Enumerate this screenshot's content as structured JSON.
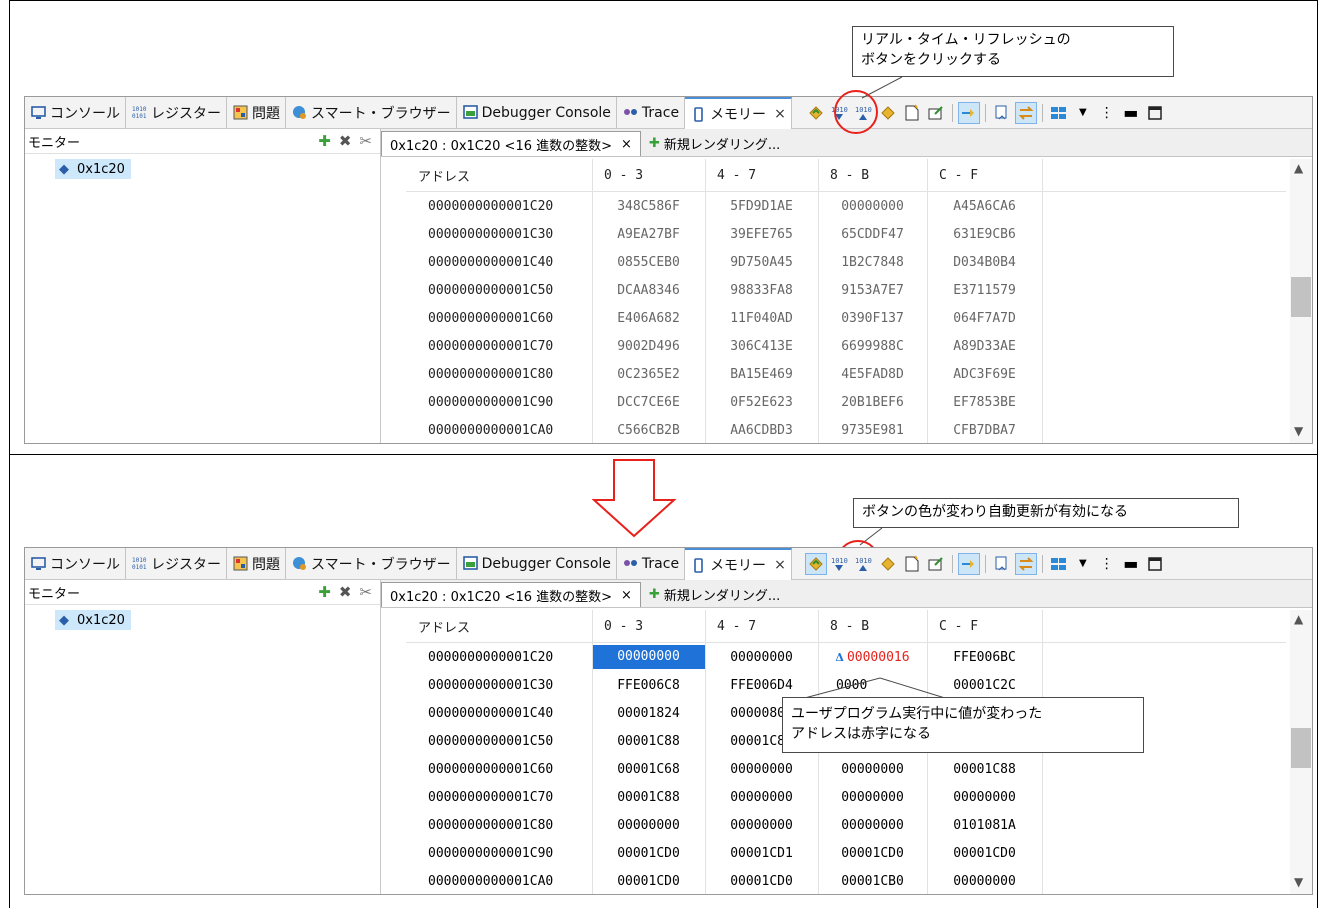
{
  "tabs": [
    {
      "label": "コンソール",
      "icon": "console-icon"
    },
    {
      "label": "レジスター",
      "icon": "binary-register-icon"
    },
    {
      "label": "問題",
      "icon": "problems-icon"
    },
    {
      "label": "スマート・ブラウザー",
      "icon": "smart-browser-icon"
    },
    {
      "label": "Debugger Console",
      "icon": "debugger-console-icon"
    },
    {
      "label": "Trace",
      "icon": "trace-icon"
    },
    {
      "label": "メモリー",
      "icon": "memory-icon",
      "close": "×"
    }
  ],
  "monitor": {
    "title": "モニター",
    "item": "0x1c20"
  },
  "rendering": {
    "active_tab": "0x1c20 : 0x1C20 <16 進数の整数>",
    "active_close": "×",
    "new_tab": "新規レンダリング..."
  },
  "columns": [
    "アドレス",
    "0 - 3",
    "4 - 7",
    "8 - B",
    "C - F"
  ],
  "panel_before": {
    "rows": [
      [
        "0000000000001C20",
        "348C586F",
        "5FD9D1AE",
        "00000000",
        "A45A6CA6"
      ],
      [
        "0000000000001C30",
        "A9EA27BF",
        "39EFE765",
        "65CDDF47",
        "631E9CB6"
      ],
      [
        "0000000000001C40",
        "0855CEB0",
        "9D750A45",
        "1B2C7848",
        "D034B0B4"
      ],
      [
        "0000000000001C50",
        "DCAA8346",
        "98833FA8",
        "9153A7E7",
        "E3711579"
      ],
      [
        "0000000000001C60",
        "E406A682",
        "11F040AD",
        "0390F137",
        "064F7A7D"
      ],
      [
        "0000000000001C70",
        "9002D496",
        "306C413E",
        "6699988C",
        "A89D33AE"
      ],
      [
        "0000000000001C80",
        "0C2365E2",
        "BA15E469",
        "4E5FAD8D",
        "ADC3F69E"
      ],
      [
        "0000000000001C90",
        "DCC7CE6E",
        "0F52E623",
        "20B1BEF6",
        "EF7853BE"
      ],
      [
        "0000000000001CA0",
        "C566CB2B",
        "AA6CDBD3",
        "9735E981",
        "CFB7DBA7"
      ]
    ]
  },
  "panel_after": {
    "rows": [
      [
        "0000000000001C20",
        "00000000",
        "00000000",
        "00000016",
        "FFE006BC"
      ],
      [
        "0000000000001C30",
        "FFE006C8",
        "FFE006D4",
        "0000",
        "00001C2C"
      ],
      [
        "0000000000001C40",
        "00001824",
        "00000801",
        "",
        ""
      ],
      [
        "0000000000001C50",
        "00001C88",
        "00001C88",
        "",
        ""
      ],
      [
        "0000000000001C60",
        "00001C68",
        "00000000",
        "00000000",
        "00001C88"
      ],
      [
        "0000000000001C70",
        "00001C88",
        "00000000",
        "00000000",
        "00000000"
      ],
      [
        "0000000000001C80",
        "00000000",
        "00000000",
        "00000000",
        "0101081A"
      ],
      [
        "0000000000001C90",
        "00001CD0",
        "00001CD1",
        "00001CD0",
        "00001CD0"
      ],
      [
        "0000000000001CA0",
        "00001CD0",
        "00001CD0",
        "00001CB0",
        "00000000"
      ]
    ],
    "delta_mark": "Δ"
  },
  "callouts": {
    "top": "リアル・タイム・リフレッシュの\nボタンをクリックする",
    "middle": "ボタンの色が変わり自動更新が有効になる",
    "bottom": "ユーザプログラム実行中に値が変わった\nアドレスは赤字になる"
  },
  "colors": {
    "highlight_ring": "#e8211b",
    "changed_value": "#e8211b",
    "selection": "#1f73d8",
    "arrow": "#e8211b"
  }
}
